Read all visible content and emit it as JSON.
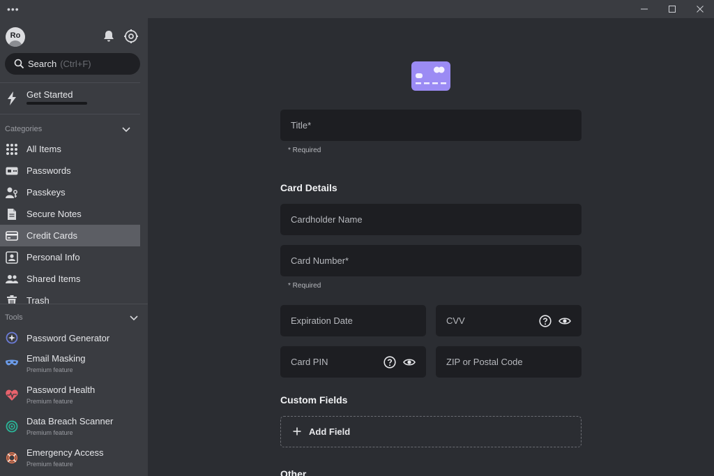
{
  "titlebar": {
    "menu": "•••"
  },
  "sidebar": {
    "avatar_initials": "Ro",
    "search": {
      "label": "Search",
      "hint": "(Ctrl+F)"
    },
    "get_started": "Get Started",
    "categories_label": "Categories",
    "categories": [
      {
        "label": "All Items",
        "icon": "grid-icon"
      },
      {
        "label": "Passwords",
        "icon": "password-icon"
      },
      {
        "label": "Passkeys",
        "icon": "passkey-icon"
      },
      {
        "label": "Secure Notes",
        "icon": "note-icon"
      },
      {
        "label": "Credit Cards",
        "icon": "credit-card-icon",
        "active": true
      },
      {
        "label": "Personal Info",
        "icon": "id-card-icon"
      },
      {
        "label": "Shared Items",
        "icon": "users-icon"
      },
      {
        "label": "Trash",
        "icon": "trash-icon"
      }
    ],
    "tools_label": "Tools",
    "tools": [
      {
        "label": "Password Generator",
        "sub": "",
        "icon": "generator-icon"
      },
      {
        "label": "Email Masking",
        "sub": "Premium feature",
        "icon": "mask-icon"
      },
      {
        "label": "Password Health",
        "sub": "Premium feature",
        "icon": "heart-pulse-icon"
      },
      {
        "label": "Data Breach Scanner",
        "sub": "Premium feature",
        "icon": "radar-icon"
      },
      {
        "label": "Emergency Access",
        "sub": "Premium feature",
        "icon": "lifebuoy-icon"
      }
    ]
  },
  "form": {
    "title_label": "Title*",
    "required_hint": "* Required",
    "card_details_heading": "Card Details",
    "cardholder_label": "Cardholder Name",
    "card_number_label": "Card Number*",
    "card_number_hint": "* Required",
    "expiration_label": "Expiration Date",
    "cvv_label": "CVV",
    "pin_label": "Card PIN",
    "zip_label": "ZIP or Postal Code",
    "custom_fields_heading": "Custom Fields",
    "add_field_label": "Add Field",
    "other_heading": "Other"
  },
  "colors": {
    "accent": "#9b8bf4",
    "sidebar_bg": "#3a3c41",
    "main_bg": "#2b2d32",
    "field_bg": "#1d1e22"
  }
}
